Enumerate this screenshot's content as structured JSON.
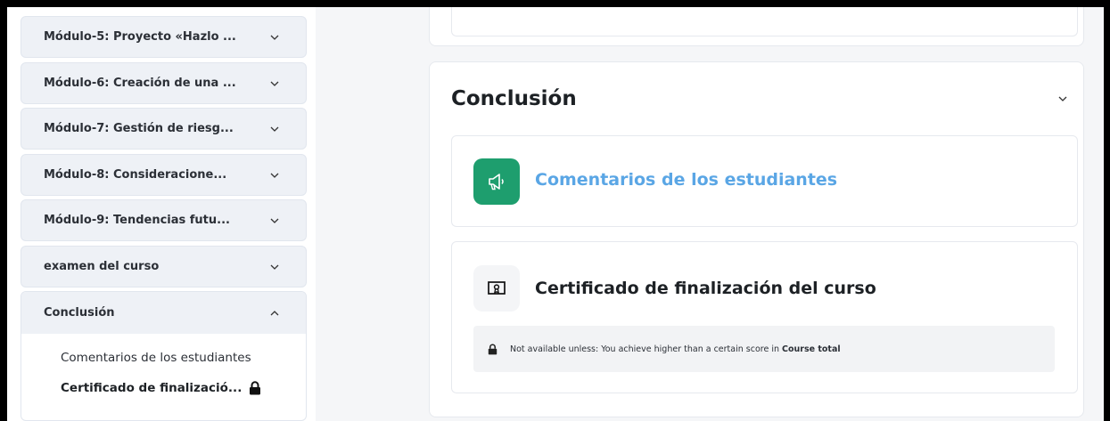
{
  "sidebar": {
    "modules": [
      {
        "label": "Módulo-5: Proyecto «Hazlo ...",
        "state": "collapsed"
      },
      {
        "label": "Módulo-6: Creación de una ...",
        "state": "collapsed"
      },
      {
        "label": "Módulo-7: Gestión de riesg...",
        "state": "collapsed"
      },
      {
        "label": "Módulo-8: Consideracione...",
        "state": "collapsed"
      },
      {
        "label": "Módulo-9: Tendencias futu...",
        "state": "collapsed"
      },
      {
        "label": "examen del curso",
        "state": "collapsed"
      }
    ],
    "conclusion": {
      "label": "Conclusión",
      "state": "expanded",
      "items": [
        {
          "label": "Comentarios de los estudiantes"
        },
        {
          "label": "Certificado de finalizació...",
          "locked": true
        }
      ]
    }
  },
  "main": {
    "section_title": "Conclusión",
    "activities": [
      {
        "name": "Comentarios de los estudiantes",
        "icon": "megaphone-icon",
        "icon_color": "#1e9e6e",
        "name_color": "#5aa6e5"
      },
      {
        "name": "Certificado de finalización del curso",
        "icon": "certificate-icon",
        "restriction": {
          "prefix": "Not available unless: You achieve higher than a certain score in",
          "target": "Course total"
        }
      }
    ]
  },
  "colors": {
    "sidebar_item_bg": "#eef1f6",
    "page_bg": "#f5f6f8",
    "accent_link": "#5aa6e5",
    "feedback_green": "#1e9e6e"
  }
}
